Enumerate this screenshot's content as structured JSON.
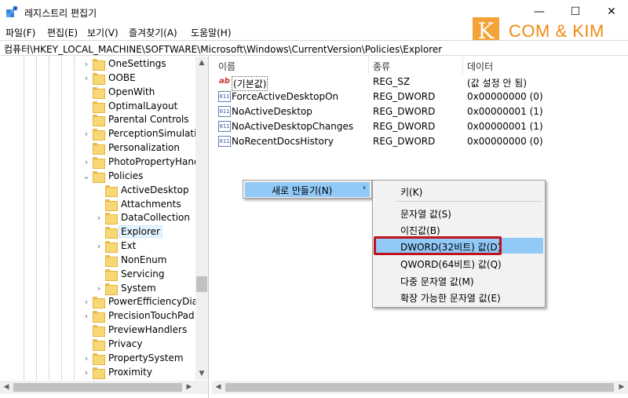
{
  "window": {
    "title": "레지스트리 편집기",
    "controls": {
      "minimize": "—",
      "maximize": "☐",
      "close": "✕"
    }
  },
  "menu": [
    "파일(F)",
    "편집(E)",
    "보기(V)",
    "즐겨찾기(A)",
    "도움말(H)"
  ],
  "brand": {
    "k": "K",
    "text": "COM & KIM"
  },
  "address": "컴퓨터\\HKEY_LOCAL_MACHINE\\SOFTWARE\\Microsoft\\Windows\\CurrentVersion\\Policies\\Explorer",
  "tree": {
    "items": [
      {
        "label": "OneSettings",
        "chevron": "›",
        "level": 1
      },
      {
        "label": "OOBE",
        "chevron": "›",
        "level": 1
      },
      {
        "label": "OpenWith",
        "chevron": "",
        "level": 1
      },
      {
        "label": "OptimalLayout",
        "chevron": "",
        "level": 1
      },
      {
        "label": "Parental Controls",
        "chevron": "",
        "level": 1
      },
      {
        "label": "PerceptionSimulation",
        "chevron": "›",
        "level": 1
      },
      {
        "label": "Personalization",
        "chevron": "",
        "level": 1
      },
      {
        "label": "PhotoPropertyHandler",
        "chevron": "›",
        "level": 1
      },
      {
        "label": "Policies",
        "chevron": "⌄",
        "level": 1
      },
      {
        "label": "ActiveDesktop",
        "chevron": "",
        "level": 2
      },
      {
        "label": "Attachments",
        "chevron": "",
        "level": 2
      },
      {
        "label": "DataCollection",
        "chevron": "›",
        "level": 2
      },
      {
        "label": "Explorer",
        "chevron": "",
        "level": 2,
        "selected": true
      },
      {
        "label": "Ext",
        "chevron": "›",
        "level": 2
      },
      {
        "label": "NonEnum",
        "chevron": "",
        "level": 2
      },
      {
        "label": "Servicing",
        "chevron": "",
        "level": 2
      },
      {
        "label": "System",
        "chevron": "›",
        "level": 2
      },
      {
        "label": "PowerEfficiencyDiagnostics",
        "chevron": "›",
        "level": 1
      },
      {
        "label": "PrecisionTouchPad",
        "chevron": "›",
        "level": 1
      },
      {
        "label": "PreviewHandlers",
        "chevron": "",
        "level": 1
      },
      {
        "label": "Privacy",
        "chevron": "",
        "level": 1
      },
      {
        "label": "PropertySystem",
        "chevron": "›",
        "level": 1
      },
      {
        "label": "Proximity",
        "chevron": "›",
        "level": 1
      }
    ]
  },
  "list": {
    "columns": [
      "이름",
      "종류",
      "데이터"
    ],
    "rows": [
      {
        "icon": "string-value-icon",
        "name": "(기본값)",
        "type": "REG_SZ",
        "data": "(값 설정 안 됨)"
      },
      {
        "icon": "binary-value-icon",
        "name": "ForceActiveDesktopOn",
        "type": "REG_DWORD",
        "data": "0x00000000 (0)"
      },
      {
        "icon": "binary-value-icon",
        "name": "NoActiveDesktop",
        "type": "REG_DWORD",
        "data": "0x00000001 (1)"
      },
      {
        "icon": "binary-value-icon",
        "name": "NoActiveDesktopChanges",
        "type": "REG_DWORD",
        "data": "0x00000001 (1)"
      },
      {
        "icon": "binary-value-icon",
        "name": "NoRecentDocsHistory",
        "type": "REG_DWORD",
        "data": "0x00000000 (0)"
      }
    ]
  },
  "context_menu": {
    "main_label": "새로 만들기(N)",
    "main_arrow": "›",
    "submenu": [
      "키(K)",
      "문자열 값(S)",
      "이진값(B)",
      "DWORD(32비트) 값(D)",
      "QWORD(64비트) 값(Q)",
      "다중 문자열 값(M)",
      "확장 가능한 문자열 값(E)"
    ],
    "highlighted": "DWORD(32비트) 값(D)"
  },
  "colors": {
    "menu_highlight": "#91c9f7",
    "annotation_box": "#c0121d",
    "brand": "#f08a12"
  }
}
